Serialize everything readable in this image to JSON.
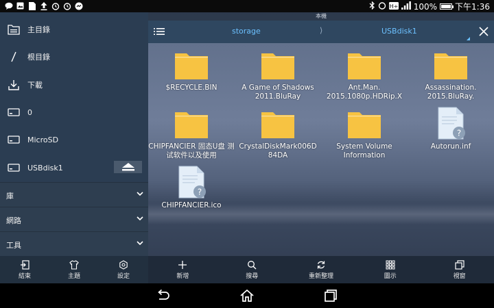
{
  "status_bar": {
    "left_icons": [
      "chat-icon",
      "image-icon",
      "document-icon",
      "upload-icon",
      "alarm-icon",
      "alarm-icon",
      "messenger-icon"
    ],
    "battery_percent": "100%",
    "battery_level": 1.0,
    "time": "下午1:36"
  },
  "sidebar": {
    "items": [
      {
        "label": "主目錄",
        "icon": "home-folder-icon"
      },
      {
        "label": "根目錄",
        "icon": "root-slash-icon"
      },
      {
        "label": "下載",
        "icon": "download-icon"
      },
      {
        "label": "0",
        "icon": "storage-device-icon"
      },
      {
        "label": "MicroSD",
        "icon": "sdcard-icon"
      },
      {
        "label": "USBdisk1",
        "icon": "usb-drive-icon"
      }
    ],
    "sections": [
      {
        "label": "庫"
      },
      {
        "label": "網路"
      },
      {
        "label": "工具"
      }
    ],
    "bottom_buttons": [
      {
        "label": "結束",
        "icon": "exit-icon"
      },
      {
        "label": "主題",
        "icon": "theme-shirt-icon"
      },
      {
        "label": "設定",
        "icon": "gear-icon"
      }
    ]
  },
  "toolbar": {
    "top_strip": "本機",
    "crumbs": [
      "storage",
      "USBdisk1"
    ],
    "crumb_separator": "⟩",
    "accent": "#6cc1ff"
  },
  "files": [
    {
      "name": "$RECYCLE.BIN",
      "type": "folder"
    },
    {
      "name": "A Game of Shadows 2011.BluRay",
      "type": "folder"
    },
    {
      "name": "Ant.Man. 2015.1080p.HDRip.X",
      "type": "folder"
    },
    {
      "name": "Assassination. 2015.BluRay.",
      "type": "folder"
    },
    {
      "name": "CHIPFANCIER 固态U盘 测试软件以及使用",
      "type": "folder"
    },
    {
      "name": "CrystalDiskMark006D 84DA",
      "type": "folder"
    },
    {
      "name": "System Volume Information",
      "type": "folder"
    },
    {
      "name": "Autorun.inf",
      "type": "unknown-file"
    },
    {
      "name": "CHIPFANCIER.ico",
      "type": "unknown-file"
    }
  ],
  "bottom_actions": [
    {
      "label": "新增",
      "icon": "plus-icon"
    },
    {
      "label": "搜尋",
      "icon": "search-icon"
    },
    {
      "label": "重新整理",
      "icon": "refresh-icon"
    },
    {
      "label": "圖示",
      "icon": "grid-view-icon"
    },
    {
      "label": "視窗",
      "icon": "windows-icon"
    }
  ],
  "colors": {
    "sidebar_bg": "#2b3d52",
    "toolbar_bg": "#2f4760",
    "folder_yellow": "#f6c342"
  }
}
